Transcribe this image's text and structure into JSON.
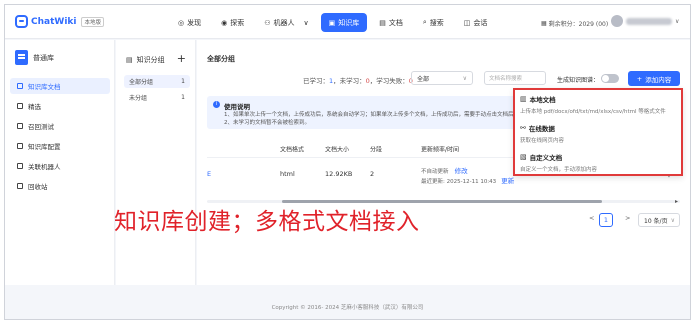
{
  "app": {
    "name": "ChatWiki",
    "badge": "本地版"
  },
  "nav": [
    {
      "label": "发现",
      "icon": "compass-icon",
      "glyph": "◎",
      "active": false
    },
    {
      "label": "探索",
      "icon": "eye-icon",
      "glyph": "◉",
      "active": false
    },
    {
      "label": "机器人",
      "icon": "robot-icon",
      "glyph": "⚇",
      "active": false,
      "dropdown": "∨"
    },
    {
      "label": "知识库",
      "icon": "book-icon",
      "glyph": "▣",
      "active": true
    },
    {
      "label": "文档",
      "icon": "document-icon",
      "glyph": "▤",
      "active": false
    },
    {
      "label": "搜索",
      "icon": "search-icon",
      "glyph": "⌕",
      "active": false
    },
    {
      "label": "会话",
      "icon": "chat-icon",
      "glyph": "◫",
      "active": false
    }
  ],
  "header": {
    "points_label": "剩余积分：2029 (00)",
    "points_icon": "coin-icon",
    "user_dropdown": "∨"
  },
  "sidebar": {
    "library_name": "普通库",
    "items": [
      {
        "label": "知识库文档",
        "active": true
      },
      {
        "label": "精选",
        "active": false
      },
      {
        "label": "召回测试",
        "active": false
      },
      {
        "label": "知识库配置",
        "active": false
      },
      {
        "label": "关联机器人",
        "active": false
      },
      {
        "label": "回收站",
        "active": false
      }
    ]
  },
  "groups": {
    "title": "知识分组",
    "add": "+",
    "items": [
      {
        "label": "全部分组",
        "count": "1",
        "active": true
      },
      {
        "label": "未分组",
        "count": "1",
        "active": false
      }
    ]
  },
  "main": {
    "title": "全部分组",
    "stats": {
      "learned_label": "已学习：",
      "learned": "1",
      "unlearned_label": "，未学习：",
      "unlearned": "0",
      "failed_label": "，学习失败：",
      "failed": "0"
    },
    "filter_value": "全部",
    "search_placeholder": "文档名称搜索",
    "gen_label": "生成知识图谱：",
    "add_button": "添加内容",
    "notice": {
      "title": "使用说明",
      "line1": "1、如果单次上传一个文档，上传成功后，系统会自动学习；如果单次上传多个文档，上传成功后，需要手动点击文档后面的【学习】按钮进行学习",
      "line2": "2、未学习的文档暂不会被检索到。"
    },
    "table": {
      "headers": [
        "文档格式",
        "文档大小",
        "分段",
        "更新频率/时间"
      ],
      "row": {
        "left_marker": "E",
        "format": "html",
        "size": "12.92KB",
        "segments": "2",
        "freq": "不自动更新",
        "freq_action": "修改",
        "updated": "最近更新: 2025-12-11 10:43",
        "update_action": "更新",
        "col5": "0",
        "col6": "0"
      }
    },
    "pager": {
      "prev": "<",
      "page": "1",
      "next": ">",
      "size": "10 条/页"
    }
  },
  "popup": {
    "items": [
      {
        "title": "本地文档",
        "desc": "上传本地 pdf/docx/ofd/txt/md/xlsx/csv/html 等格式文件"
      },
      {
        "title": "在线数据",
        "desc": "获取在线网页内容"
      },
      {
        "title": "自定义文档",
        "desc": "自定义一个文档，手动添加内容"
      }
    ]
  },
  "caption": "知识库创建；多格式文档接入",
  "footer": "Copyright © 2016- 2024 芝麻小客服科技（武汉）有限公司",
  "colors": {
    "accent": "#2f6bff",
    "highlight": "#e03a3a",
    "caption": "#e0222a"
  }
}
